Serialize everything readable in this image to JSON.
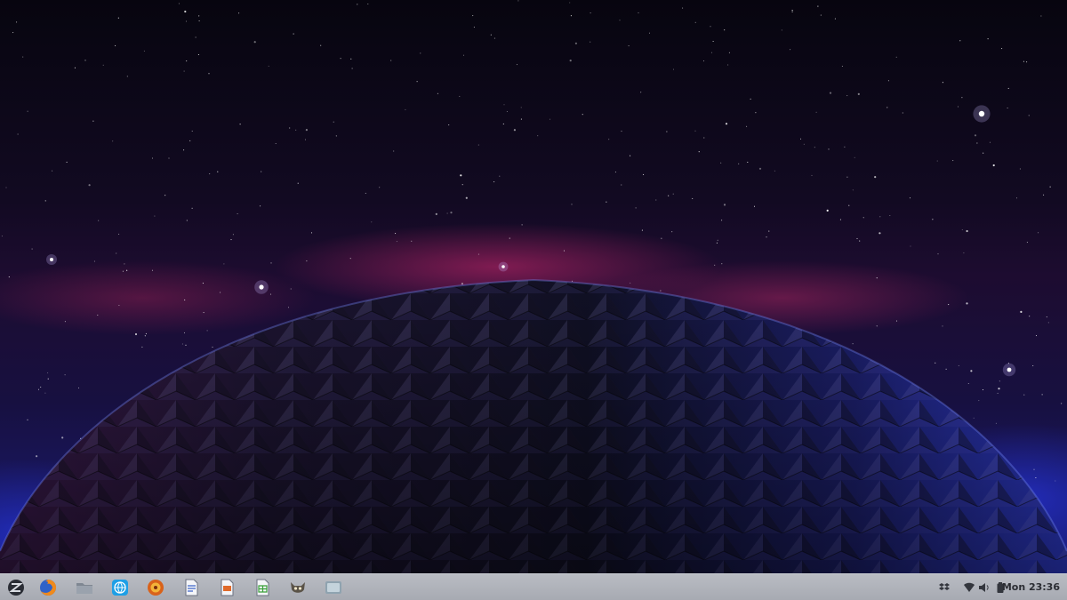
{
  "desktop": {
    "wallpaper": "space-dome",
    "colors": {
      "sky_top": "#07050f",
      "nebula": "#d2286e",
      "glow_blue": "#2838ff"
    }
  },
  "taskbar": {
    "background": "#b0b3ba",
    "launchers": [
      {
        "name": "zorin-menu",
        "icon": "zorin-logo-icon"
      },
      {
        "name": "firefox",
        "icon": "firefox-icon"
      },
      {
        "name": "files",
        "icon": "folder-icon"
      },
      {
        "name": "web-browser",
        "icon": "globe-icon"
      },
      {
        "name": "music-player",
        "icon": "music-player-icon"
      },
      {
        "name": "document-viewer",
        "icon": "document-icon"
      },
      {
        "name": "presentation",
        "icon": "presentation-icon"
      },
      {
        "name": "spreadsheet",
        "icon": "spreadsheet-icon"
      },
      {
        "name": "gimp",
        "icon": "gimp-icon"
      },
      {
        "name": "screenshot",
        "icon": "screenshot-icon"
      }
    ],
    "tray": [
      {
        "name": "dropbox",
        "icon": "dropbox-icon"
      },
      {
        "name": "network",
        "icon": "wifi-icon"
      },
      {
        "name": "volume",
        "icon": "speaker-icon"
      },
      {
        "name": "battery",
        "icon": "battery-icon"
      }
    ],
    "clock": "Mon 23:36"
  }
}
